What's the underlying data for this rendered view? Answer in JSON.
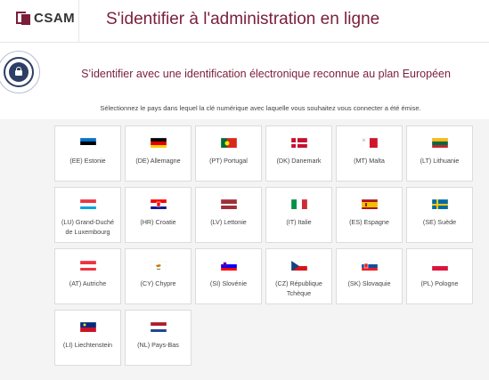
{
  "header": {
    "logo_text": "CSAM",
    "title": "S'identifier à l'administration en ligne"
  },
  "main": {
    "subtitle": "S’identifier avec une identification électronique reconnue au plan Européen",
    "instruction": "Sélectionnez le pays dans lequel la clé numérique avec laquelle vous souhaitez vous connecter a été émise."
  },
  "countries": [
    {
      "code": "EE",
      "label": "(EE) Estonie"
    },
    {
      "code": "DE",
      "label": "(DE) Allemagne"
    },
    {
      "code": "PT",
      "label": "(PT) Portugal"
    },
    {
      "code": "DK",
      "label": "(DK) Danemark"
    },
    {
      "code": "MT",
      "label": "(MT) Malta"
    },
    {
      "code": "LT",
      "label": "(LT) Lithuanie"
    },
    {
      "code": "LU",
      "label": "(LU) Grand-Duché de Luxembourg"
    },
    {
      "code": "HR",
      "label": "(HR) Croatie"
    },
    {
      "code": "LV",
      "label": "(LV) Lettonie"
    },
    {
      "code": "IT",
      "label": "(IT) Italie"
    },
    {
      "code": "ES",
      "label": "(ES) Espagne"
    },
    {
      "code": "SE",
      "label": "(SE) Suède"
    },
    {
      "code": "AT",
      "label": "(AT) Autriche"
    },
    {
      "code": "CY",
      "label": "(CY) Chypre"
    },
    {
      "code": "SI",
      "label": "(SI) Slovénie"
    },
    {
      "code": "CZ",
      "label": "(CZ) République Tchèque"
    },
    {
      "code": "SK",
      "label": "(SK) Slovaquie"
    },
    {
      "code": "PL",
      "label": "(PL) Pologne"
    },
    {
      "code": "LI",
      "label": "(LI) Liechtenstein"
    },
    {
      "code": "NL",
      "label": "(NL) Pays-Bas"
    }
  ],
  "colors": {
    "brand": "#7a1e3a",
    "badge": "#2c3e66"
  }
}
